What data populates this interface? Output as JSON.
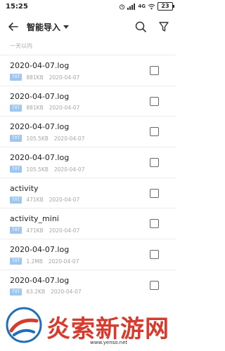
{
  "status_bar": {
    "time": "15:25",
    "signal_label": "4G",
    "battery": "23"
  },
  "header": {
    "title": "智能导入"
  },
  "section_label": "一天以内",
  "files": [
    {
      "name": "2020-04-07.log",
      "type": "TXT",
      "size": "881KB",
      "date": "2020-04-07"
    },
    {
      "name": "2020-04-07.log",
      "type": "TXT",
      "size": "881KB",
      "date": "2020-04-07"
    },
    {
      "name": "2020-04-07.log",
      "type": "TXT",
      "size": "105.5KB",
      "date": "2020-04-07"
    },
    {
      "name": "2020-04-07.log",
      "type": "TXT",
      "size": "105.5KB",
      "date": "2020-04-07"
    },
    {
      "name": "activity",
      "type": "TXT",
      "size": "471KB",
      "date": "2020-04-07"
    },
    {
      "name": "activity_mini",
      "type": "TXT",
      "size": "471KB",
      "date": "2020-04-07"
    },
    {
      "name": "2020-04-07.log",
      "type": "TXT",
      "size": "1.2MB",
      "date": "2020-04-07"
    },
    {
      "name": "2020-04-07.log",
      "type": "TXT",
      "size": "63.2KB",
      "date": "2020-04-07"
    }
  ],
  "watermark": {
    "text": "炎索新游网",
    "url": "www.yenso.net"
  },
  "colors": {
    "badge": "#9ec6ef",
    "watermark": "#d63b2d"
  }
}
